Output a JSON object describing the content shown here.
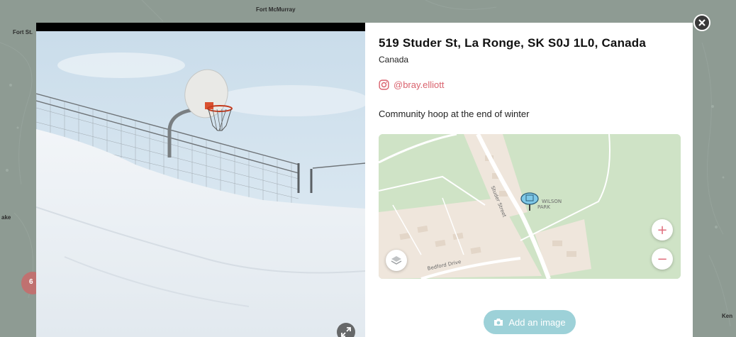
{
  "background": {
    "labels": {
      "fort_mcmurray": "Fort McMurray",
      "fort_st": "Fort St.",
      "lake": "ake",
      "ken": "Ken"
    },
    "cluster_count": "6"
  },
  "modal": {
    "title": "519 Studer St, La Ronge, SK S0J 1L0, Canada",
    "country": "Canada",
    "instagram_handle": "@bray.elliott",
    "caption": "Community hoop at the end of winter",
    "minimap": {
      "street_label": "Studer Street",
      "park_label_1": "WILSON",
      "park_label_2": "PARK",
      "drive_label": "Bedford Drive",
      "zoom_in": "+",
      "zoom_out": "−"
    },
    "add_image_label": "Add an image"
  },
  "colors": {
    "accent": "#d9626d",
    "add_button": "#9dd1d8"
  },
  "icons": {
    "close": "close-icon",
    "expand": "expand-icon",
    "instagram": "instagram-icon",
    "camera": "camera-icon",
    "layers": "layers-icon",
    "basketball_marker": "basketball-hoop-marker-icon"
  }
}
